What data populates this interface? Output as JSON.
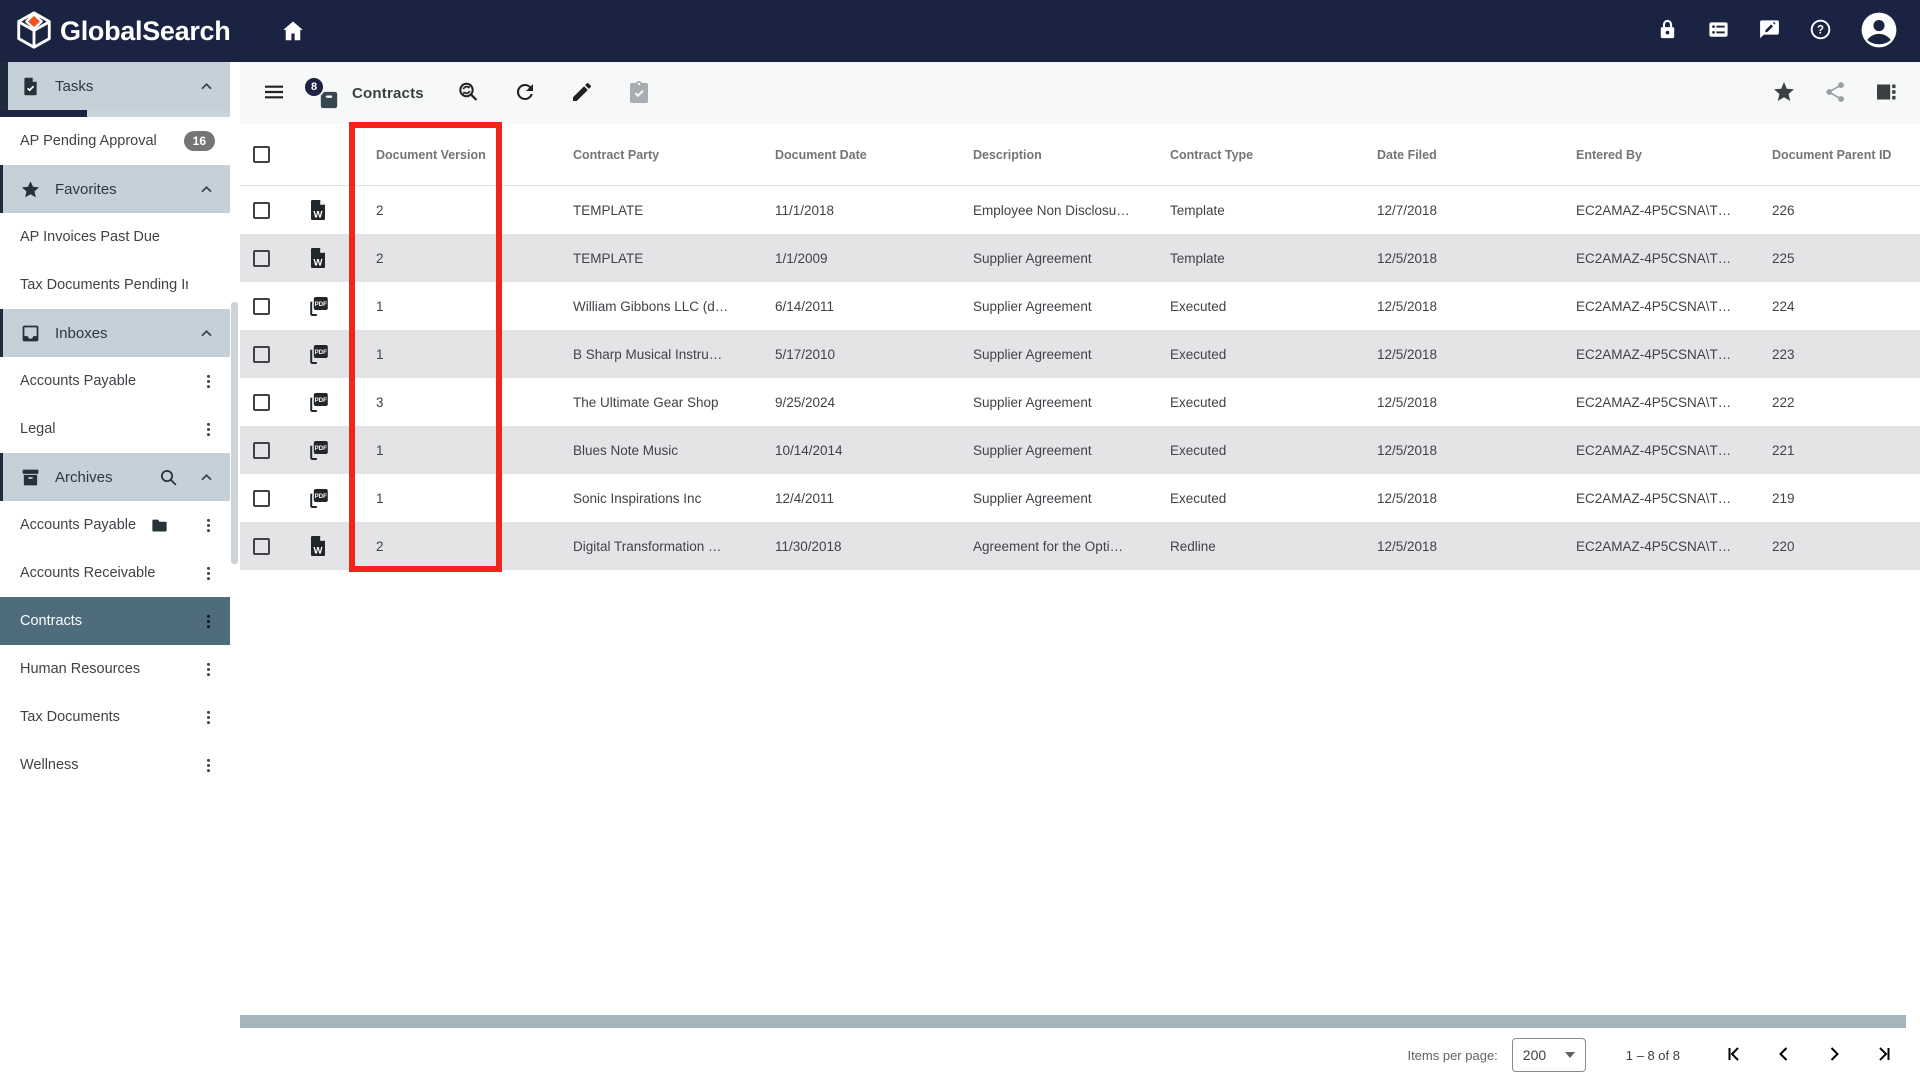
{
  "navbar": {
    "brand": "GlobalSearch"
  },
  "sidebar": {
    "tasks_progress_fraction": 0.38,
    "sections": [
      {
        "type": "header",
        "icon": "task-icon",
        "label": "Tasks",
        "chevron": "up",
        "accent": "wide",
        "progress": true
      },
      {
        "type": "item",
        "label": "AP Pending Approval",
        "badge": "16"
      },
      {
        "type": "header",
        "icon": "star-icon",
        "label": "Favorites",
        "chevron": "up"
      },
      {
        "type": "item",
        "label": "AP Invoices Past Due"
      },
      {
        "type": "item",
        "label": "Tax Documents Pending Inde…"
      },
      {
        "type": "header",
        "icon": "inbox-icon",
        "label": "Inboxes",
        "chevron": "up"
      },
      {
        "type": "item",
        "label": "Accounts Payable",
        "kebab": true
      },
      {
        "type": "item",
        "label": "Legal",
        "kebab": true
      },
      {
        "type": "header",
        "icon": "archive-icon",
        "label": "Archives",
        "chevron": "up",
        "search": true
      },
      {
        "type": "item",
        "label": "Accounts Payable",
        "folder": true,
        "kebab": true
      },
      {
        "type": "item",
        "label": "Accounts Receivable",
        "kebab": true
      },
      {
        "type": "item",
        "label": "Contracts",
        "kebab": true,
        "selected": true
      },
      {
        "type": "item",
        "label": "Human Resources",
        "kebab": true
      },
      {
        "type": "item",
        "label": "Tax Documents",
        "kebab": true
      },
      {
        "type": "item",
        "label": "Wellness",
        "kebab": true
      }
    ]
  },
  "toolbar": {
    "badge_count": "8",
    "title": "Contracts"
  },
  "table": {
    "columns": [
      "Document Version",
      "Contract Party",
      "Document Date",
      "Description",
      "Contract Type",
      "Date Filed",
      "Entered By",
      "Document Parent ID"
    ],
    "rows": [
      {
        "file_type": "word",
        "version": "2",
        "party": "TEMPLATE",
        "date": "11/1/2018",
        "description": "Employee Non Disclosu…",
        "contract_type": "Template",
        "date_filed": "12/7/2018",
        "entered_by": "EC2AMAZ-4P5CSNA\\T…",
        "parent_id": "226"
      },
      {
        "file_type": "word",
        "version": "2",
        "party": "TEMPLATE",
        "date": "1/1/2009",
        "description": "Supplier Agreement",
        "contract_type": "Template",
        "date_filed": "12/5/2018",
        "entered_by": "EC2AMAZ-4P5CSNA\\T…",
        "parent_id": "225"
      },
      {
        "file_type": "pdf",
        "version": "1",
        "party": "William Gibbons LLC (d…",
        "date": "6/14/2011",
        "description": "Supplier Agreement",
        "contract_type": "Executed",
        "date_filed": "12/5/2018",
        "entered_by": "EC2AMAZ-4P5CSNA\\T…",
        "parent_id": "224"
      },
      {
        "file_type": "pdf",
        "version": "1",
        "party": "B Sharp Musical Instru…",
        "date": "5/17/2010",
        "description": "Supplier Agreement",
        "contract_type": "Executed",
        "date_filed": "12/5/2018",
        "entered_by": "EC2AMAZ-4P5CSNA\\T…",
        "parent_id": "223"
      },
      {
        "file_type": "pdf",
        "version": "3",
        "party": "The Ultimate Gear Shop",
        "date": "9/25/2024",
        "description": "Supplier Agreement",
        "contract_type": "Executed",
        "date_filed": "12/5/2018",
        "entered_by": "EC2AMAZ-4P5CSNA\\T…",
        "parent_id": "222"
      },
      {
        "file_type": "pdf",
        "version": "1",
        "party": "Blues Note Music",
        "date": "10/14/2014",
        "description": "Supplier Agreement",
        "contract_type": "Executed",
        "date_filed": "12/5/2018",
        "entered_by": "EC2AMAZ-4P5CSNA\\T…",
        "parent_id": "221"
      },
      {
        "file_type": "pdf",
        "version": "1",
        "party": "Sonic Inspirations Inc",
        "date": "12/4/2011",
        "description": "Supplier Agreement",
        "contract_type": "Executed",
        "date_filed": "12/5/2018",
        "entered_by": "EC2AMAZ-4P5CSNA\\T…",
        "parent_id": "219"
      },
      {
        "file_type": "word",
        "version": "2",
        "party": "Digital Transformation …",
        "date": "11/30/2018",
        "description": "Agreement for the Opti…",
        "contract_type": "Redline",
        "date_filed": "12/5/2018",
        "entered_by": "EC2AMAZ-4P5CSNA\\T…",
        "parent_id": "220"
      }
    ]
  },
  "pagination": {
    "items_per_page_label": "Items per page:",
    "items_per_page_value": "200",
    "range_label": "1 – 8 of 8"
  },
  "colors": {
    "navbar_navy": "#1b2342",
    "section_header": "#c5d1d8",
    "selected_slate": "#4e6c7c",
    "row_alt": "#e4e4e7",
    "highlight_red": "#f02418",
    "scrollbar": "#a4b5be"
  }
}
